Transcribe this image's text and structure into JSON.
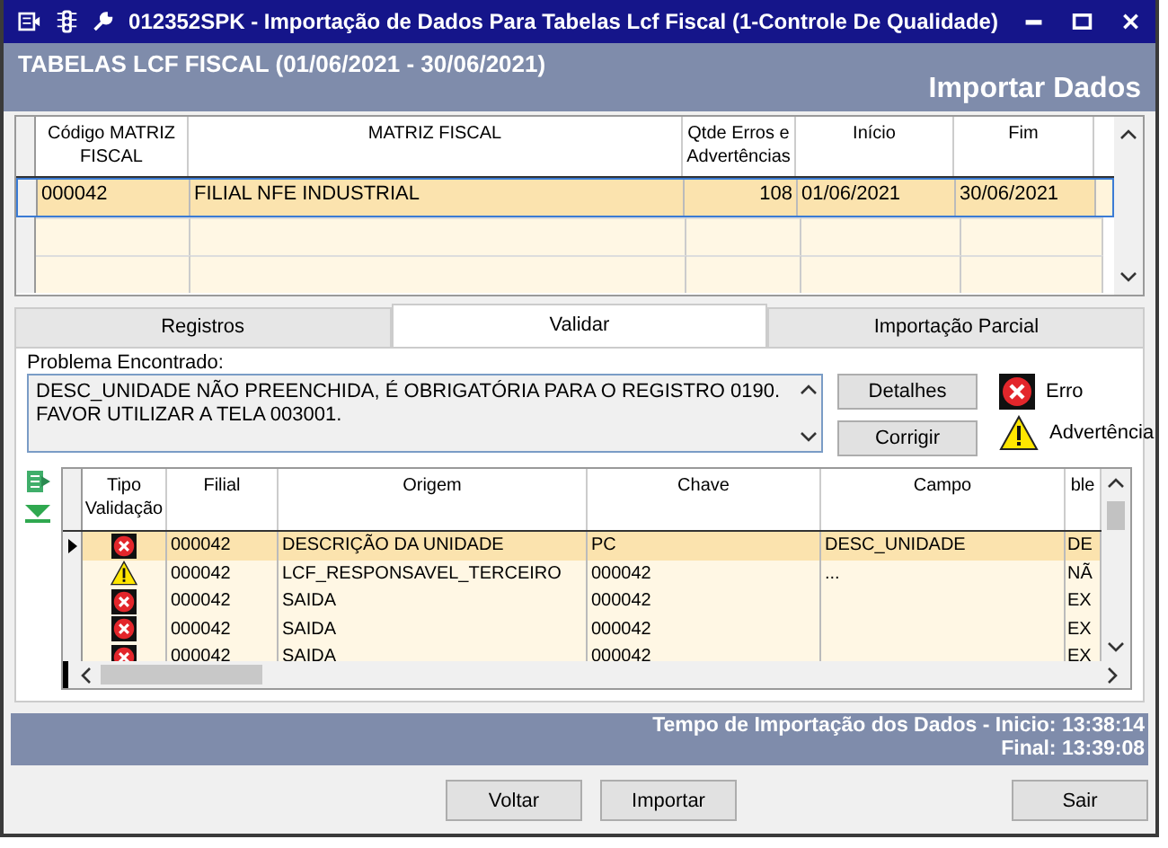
{
  "window": {
    "title": "012352SPK - Importação de Dados Para Tabelas Lcf Fiscal (1-Controle De Qualidade)"
  },
  "header": {
    "title": "TABELAS LCF FISCAL (01/06/2021 - 30/06/2021)",
    "subtitle": "Importar Dados"
  },
  "matrix_table": {
    "columns": [
      "Código MATRIZ FISCAL",
      "MATRIZ FISCAL",
      "Qtde Erros e Advertências",
      "Início",
      "Fim"
    ],
    "rows": [
      {
        "selected": true,
        "cells": [
          "000042",
          "FILIAL NFE INDUSTRIAL",
          "108",
          "01/06/2021",
          "30/06/2021"
        ]
      }
    ]
  },
  "tabs": [
    {
      "label": "Registros",
      "selected": false
    },
    {
      "label": "Validar",
      "selected": true
    },
    {
      "label": "Importação Parcial",
      "selected": false
    }
  ],
  "problem": {
    "label": "Problema Encontrado:",
    "text": "DESC_UNIDADE NÃO PREENCHIDA, É OBRIGATÓRIA PARA O REGISTRO 0190. FAVOR UTILIZAR A TELA 003001."
  },
  "actions": [
    "Detalhes",
    "Corrigir"
  ],
  "legend": [
    {
      "kind": "error",
      "label": "Erro"
    },
    {
      "kind": "warning",
      "label": "Advertência"
    }
  ],
  "validation_table": {
    "columns": [
      "Tipo Validação",
      "Filial",
      "Origem",
      "Chave",
      "Campo",
      "ble"
    ],
    "rows": [
      {
        "selected": true,
        "kind": "error",
        "cells": [
          "",
          "000042",
          "DESCRIÇÃO DA UNIDADE",
          "PC",
          "DESC_UNIDADE",
          "DE"
        ]
      },
      {
        "selected": false,
        "kind": "warning",
        "cells": [
          "",
          "000042",
          "LCF_RESPONSAVEL_TERCEIRO",
          "000042",
          "...",
          "NÃ"
        ]
      },
      {
        "selected": false,
        "kind": "error",
        "cells": [
          "",
          "000042",
          "SAIDA",
          "000042",
          "",
          "EX"
        ]
      },
      {
        "selected": false,
        "kind": "error",
        "cells": [
          "",
          "000042",
          "SAIDA",
          "000042",
          "",
          "EX"
        ]
      },
      {
        "selected": false,
        "kind": "error",
        "cells": [
          "",
          "000042",
          "SAIDA",
          "000042",
          "",
          "EX"
        ]
      }
    ]
  },
  "status": {
    "line_1": "Tempo de Importação dos Dados - Inicio: 13:38:14",
    "line_2": "Final: 13:39:08"
  },
  "buttons": [
    "Voltar",
    "Importar",
    "Sair"
  ]
}
